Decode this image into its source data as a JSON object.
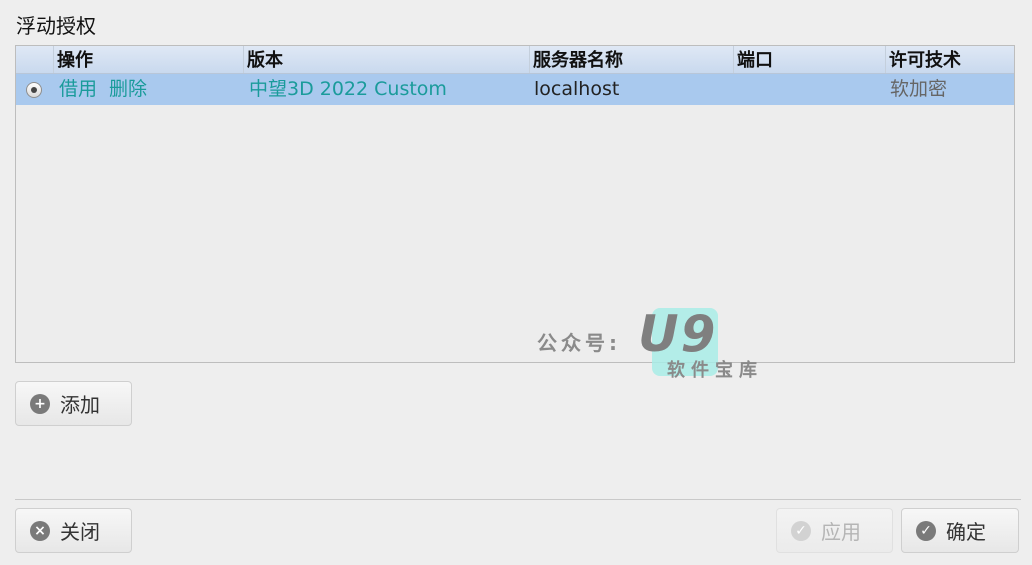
{
  "dialog": {
    "title": "浮动授权"
  },
  "table": {
    "headers": [
      "操作",
      "版本",
      "服务器名称",
      "端口",
      "许可技术"
    ],
    "rows": [
      {
        "actions": [
          "借用",
          "删除"
        ],
        "version": "中望3D 2022 Custom",
        "server": "localhost",
        "port": "",
        "license": "软加密"
      }
    ]
  },
  "buttons": {
    "add": "添加",
    "close": "关闭",
    "apply": "应用",
    "ok": "确定"
  },
  "watermark": {
    "prefix": "公众号:",
    "brand": "U9",
    "sub": "软件宝库"
  },
  "colors": {
    "selected_row": "#a9c9ee",
    "link_text": "#1a9b9b",
    "header_bg": "#c9d9ee"
  },
  "icons": {
    "add": "plus-circle-icon",
    "close": "x-circle-icon",
    "apply": "check-circle-icon",
    "ok": "check-circle-icon"
  }
}
